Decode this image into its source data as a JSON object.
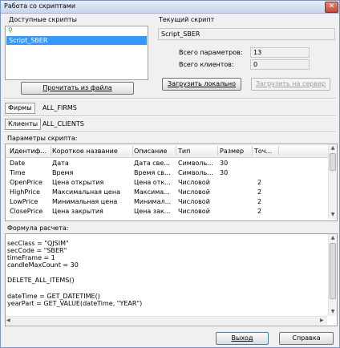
{
  "window": {
    "title": "Работа со скриптами"
  },
  "available_scripts": {
    "label": "Доступные скрипты",
    "items": [
      "Script_SBER"
    ],
    "load_file_button": "Прочитать из файла"
  },
  "current_script": {
    "label": "Текущий скрипт",
    "name": "Script_SBER",
    "total_params_label": "Всего параметров:",
    "total_params_value": "13",
    "total_clients_label": "Всего клиентов:",
    "total_clients_value": "0",
    "load_local_button": "Загрузить локально",
    "load_server_button": "Загрузить на сервер"
  },
  "firms": {
    "button": "Фирмы",
    "value": "ALL_FIRMS"
  },
  "clients": {
    "button": "Клиенты",
    "value": "ALL_CLIENTS"
  },
  "params": {
    "label": "Параметры скрипта:",
    "columns": [
      "Идентиф...",
      "Короткое название",
      "Описание",
      "Тип",
      "Размер",
      "Точ..."
    ],
    "rows": [
      [
        "Date",
        "Дата",
        "Дата све...",
        "Символь...",
        "30",
        ""
      ],
      [
        "Time",
        "Время",
        "Время св...",
        "Символь...",
        "30",
        ""
      ],
      [
        "OpenPrice",
        "Цена открытия",
        "Цена отк...",
        "Числовой",
        "",
        "2"
      ],
      [
        "HighPrice",
        "Максимальная цена",
        "Максима...",
        "Числовой",
        "",
        "2"
      ],
      [
        "LowPrice",
        "Минимальная цена",
        "Минимал...",
        "Числовой",
        "",
        "2"
      ],
      [
        "ClosePrice",
        "Цена закрытия",
        "Цена зак...",
        "Числовой",
        "",
        "2"
      ]
    ]
  },
  "formula": {
    "label": "Формула расчета:",
    "lines": [
      "secClass = \"QJSIM\"",
      "secCode = \"SBER\"",
      "timeFrame = 1",
      "candleMaxCount = 30",
      "",
      "DELETE_ALL_ITEMS()",
      "",
      "dateTime = GET_DATETIME()",
      "yearPart = GET_VALUE(dateTime, \"YEAR\")"
    ]
  },
  "footer": {
    "exit_button": "Выход",
    "help_button": "Справка"
  }
}
